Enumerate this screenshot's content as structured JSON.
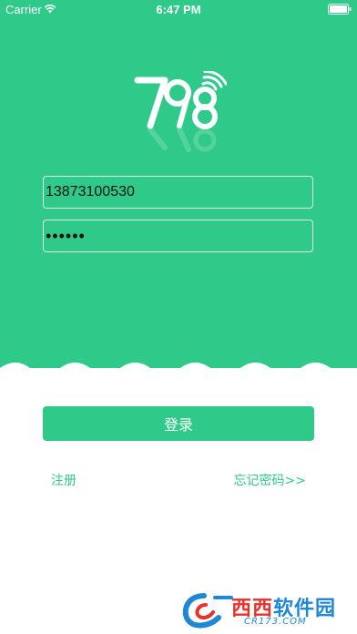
{
  "colors": {
    "primary": "#2fca8a",
    "field_border": "#ffffff",
    "watermark_blue": "#1e88d6",
    "watermark_red": "#e8312b"
  },
  "status_bar": {
    "carrier": "Carrier",
    "time": "6:47 PM",
    "icons": [
      "wifi-icon",
      "battery-icon"
    ]
  },
  "logo": {
    "text": "798",
    "icon": "signal-arcs-icon"
  },
  "login_form": {
    "phone_value": "13873100530",
    "password_value": "••••••",
    "login_label": "登录",
    "register_label": "注册",
    "forgot_label": "忘记密码>>"
  },
  "watermark": {
    "brand_red": "西西",
    "brand_blue": "软件园",
    "domain": "CR173.COM"
  }
}
